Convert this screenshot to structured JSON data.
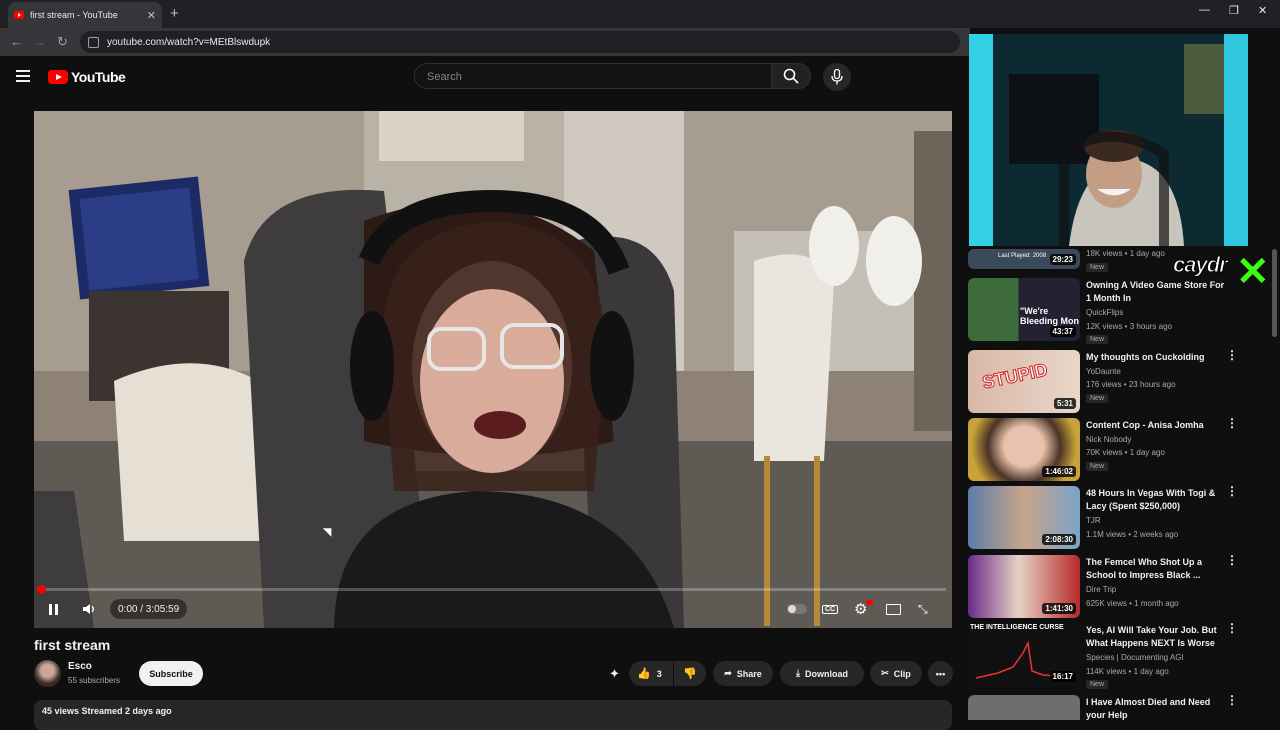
{
  "browser": {
    "tab_title": "first stream - YouTube",
    "new_tab": "+",
    "url": "youtube.com/watch?v=MEtBlswdupk"
  },
  "header": {
    "logo_text": "YouTube",
    "search_placeholder": "Search"
  },
  "player": {
    "time": "0:00 / 3:05:59",
    "progress": 0
  },
  "video": {
    "title": "first stream",
    "channel": "Esco",
    "subscribers": "55 subscribers",
    "subscribe_label": "Subscribe",
    "likes": "3",
    "share_label": "Share",
    "download_label": "Download",
    "clip_label": "Clip",
    "meta": "45 views  Streamed 2 days ago"
  },
  "overlay": {
    "streamer_tag": "caydr",
    "last_played": "Last Played: 2008"
  },
  "recommendations": [
    {
      "title": "",
      "channel": "",
      "meta": "18K views • 1 day ago",
      "badge": "New",
      "duration": "29:23"
    },
    {
      "title": "Owning A Video Game Store For 1 Month In",
      "channel": "QuickFlips",
      "meta": "12K views • 3 hours ago",
      "badge": "New",
      "duration": "43:37",
      "thumb_text": "\"We're Bleeding Mon"
    },
    {
      "title": "My thoughts on Cuckolding",
      "channel": "YoDaunte",
      "meta": "176 views • 23 hours ago",
      "badge": "New",
      "duration": "5:31",
      "thumb_text": "STUPID"
    },
    {
      "title": "Content Cop - Anisa Jomha",
      "channel": "Nick Nobody",
      "meta": "70K views • 1 day ago",
      "badge": "New",
      "duration": "1:46:02"
    },
    {
      "title": "48 Hours In Vegas With Togi & Lacy (Spent $250,000)",
      "channel": "TJR",
      "meta": "1.1M views • 2 weeks ago",
      "badge": "",
      "duration": "2:08:30"
    },
    {
      "title": "The Femcel Who Shot Up a School to Impress Black ...",
      "channel": "Dire Trip",
      "meta": "625K views • 1 month ago",
      "badge": "",
      "duration": "1:41:30"
    },
    {
      "title": "Yes, AI Will Take Your Job. But What Happens NEXT Is Worse",
      "channel": "Species | Documenting AGI",
      "meta": "114K views • 1 day ago",
      "badge": "New",
      "duration": "16:17",
      "thumb_text": "THE INTELLIGENCE CURSE"
    },
    {
      "title": "I Have Almost Died and Need your Help",
      "channel": "",
      "meta": "",
      "badge": "",
      "duration": ""
    }
  ]
}
